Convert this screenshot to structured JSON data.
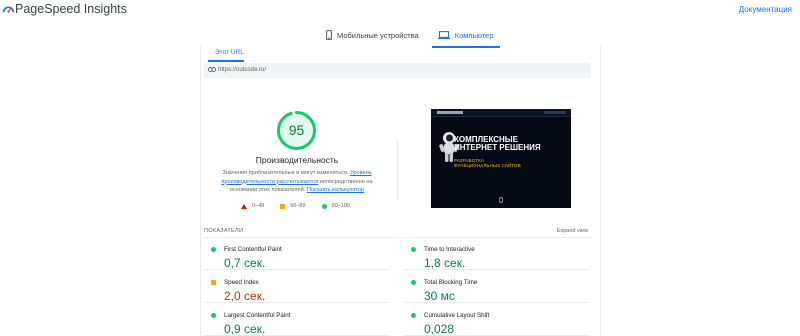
{
  "app": {
    "title": "PageSpeed Insights",
    "doc_link": "Документация"
  },
  "device_tabs": [
    {
      "label": "Мобильные устройства",
      "icon": "smartphone-icon",
      "active": false
    },
    {
      "label": "Компьютер",
      "icon": "laptop-icon",
      "active": true
    }
  ],
  "url_section": {
    "tab_label": "Этот URL",
    "url": "https://outcode.ru/"
  },
  "performance": {
    "score": "95",
    "label": "Производительность",
    "desc_prefix": "Значения приблизительные и могут изменяться.",
    "desc_link1": "Уровень производительности рассчитывается",
    "desc_middle": "непосредственно на основании этих показателей.",
    "desc_link2": "Показать калькулятор",
    "score_color": "#0cce6b"
  },
  "legend": [
    {
      "range": "0–49",
      "shape": "triangle",
      "color": "#eb0f00"
    },
    {
      "range": "50–89",
      "shape": "square",
      "color": "#ffa400"
    },
    {
      "range": "90–100",
      "shape": "circle",
      "color": "#0cce6b"
    }
  ],
  "screenshot": {
    "heading_line1": "КОМПЛЕКСНЫЕ",
    "heading_line2": "ИНТЕРНЕТ РЕШЕНИЯ",
    "sub_line1": "РАЗРАБОТКА",
    "sub_line2": "ФУНКЦИОНАЛЬНЫХ САЙТОВ"
  },
  "metrics": {
    "header": "ПОКАЗАТЕЛИ",
    "expand": "Expand view",
    "items": [
      {
        "name": "First Contentful Paint",
        "value": "0,7 сек.",
        "status": "good"
      },
      {
        "name": "Time to Interactive",
        "value": "1,8 сек.",
        "status": "good"
      },
      {
        "name": "Speed Index",
        "value": "2,0 сек.",
        "status": "average"
      },
      {
        "name": "Total Blocking Time",
        "value": "30 мс",
        "status": "good"
      },
      {
        "name": "Largest Contentful Paint",
        "value": "0,9 сек.",
        "status": "good"
      },
      {
        "name": "Cumulative Layout Shift",
        "value": "0,028",
        "status": "good"
      }
    ]
  }
}
